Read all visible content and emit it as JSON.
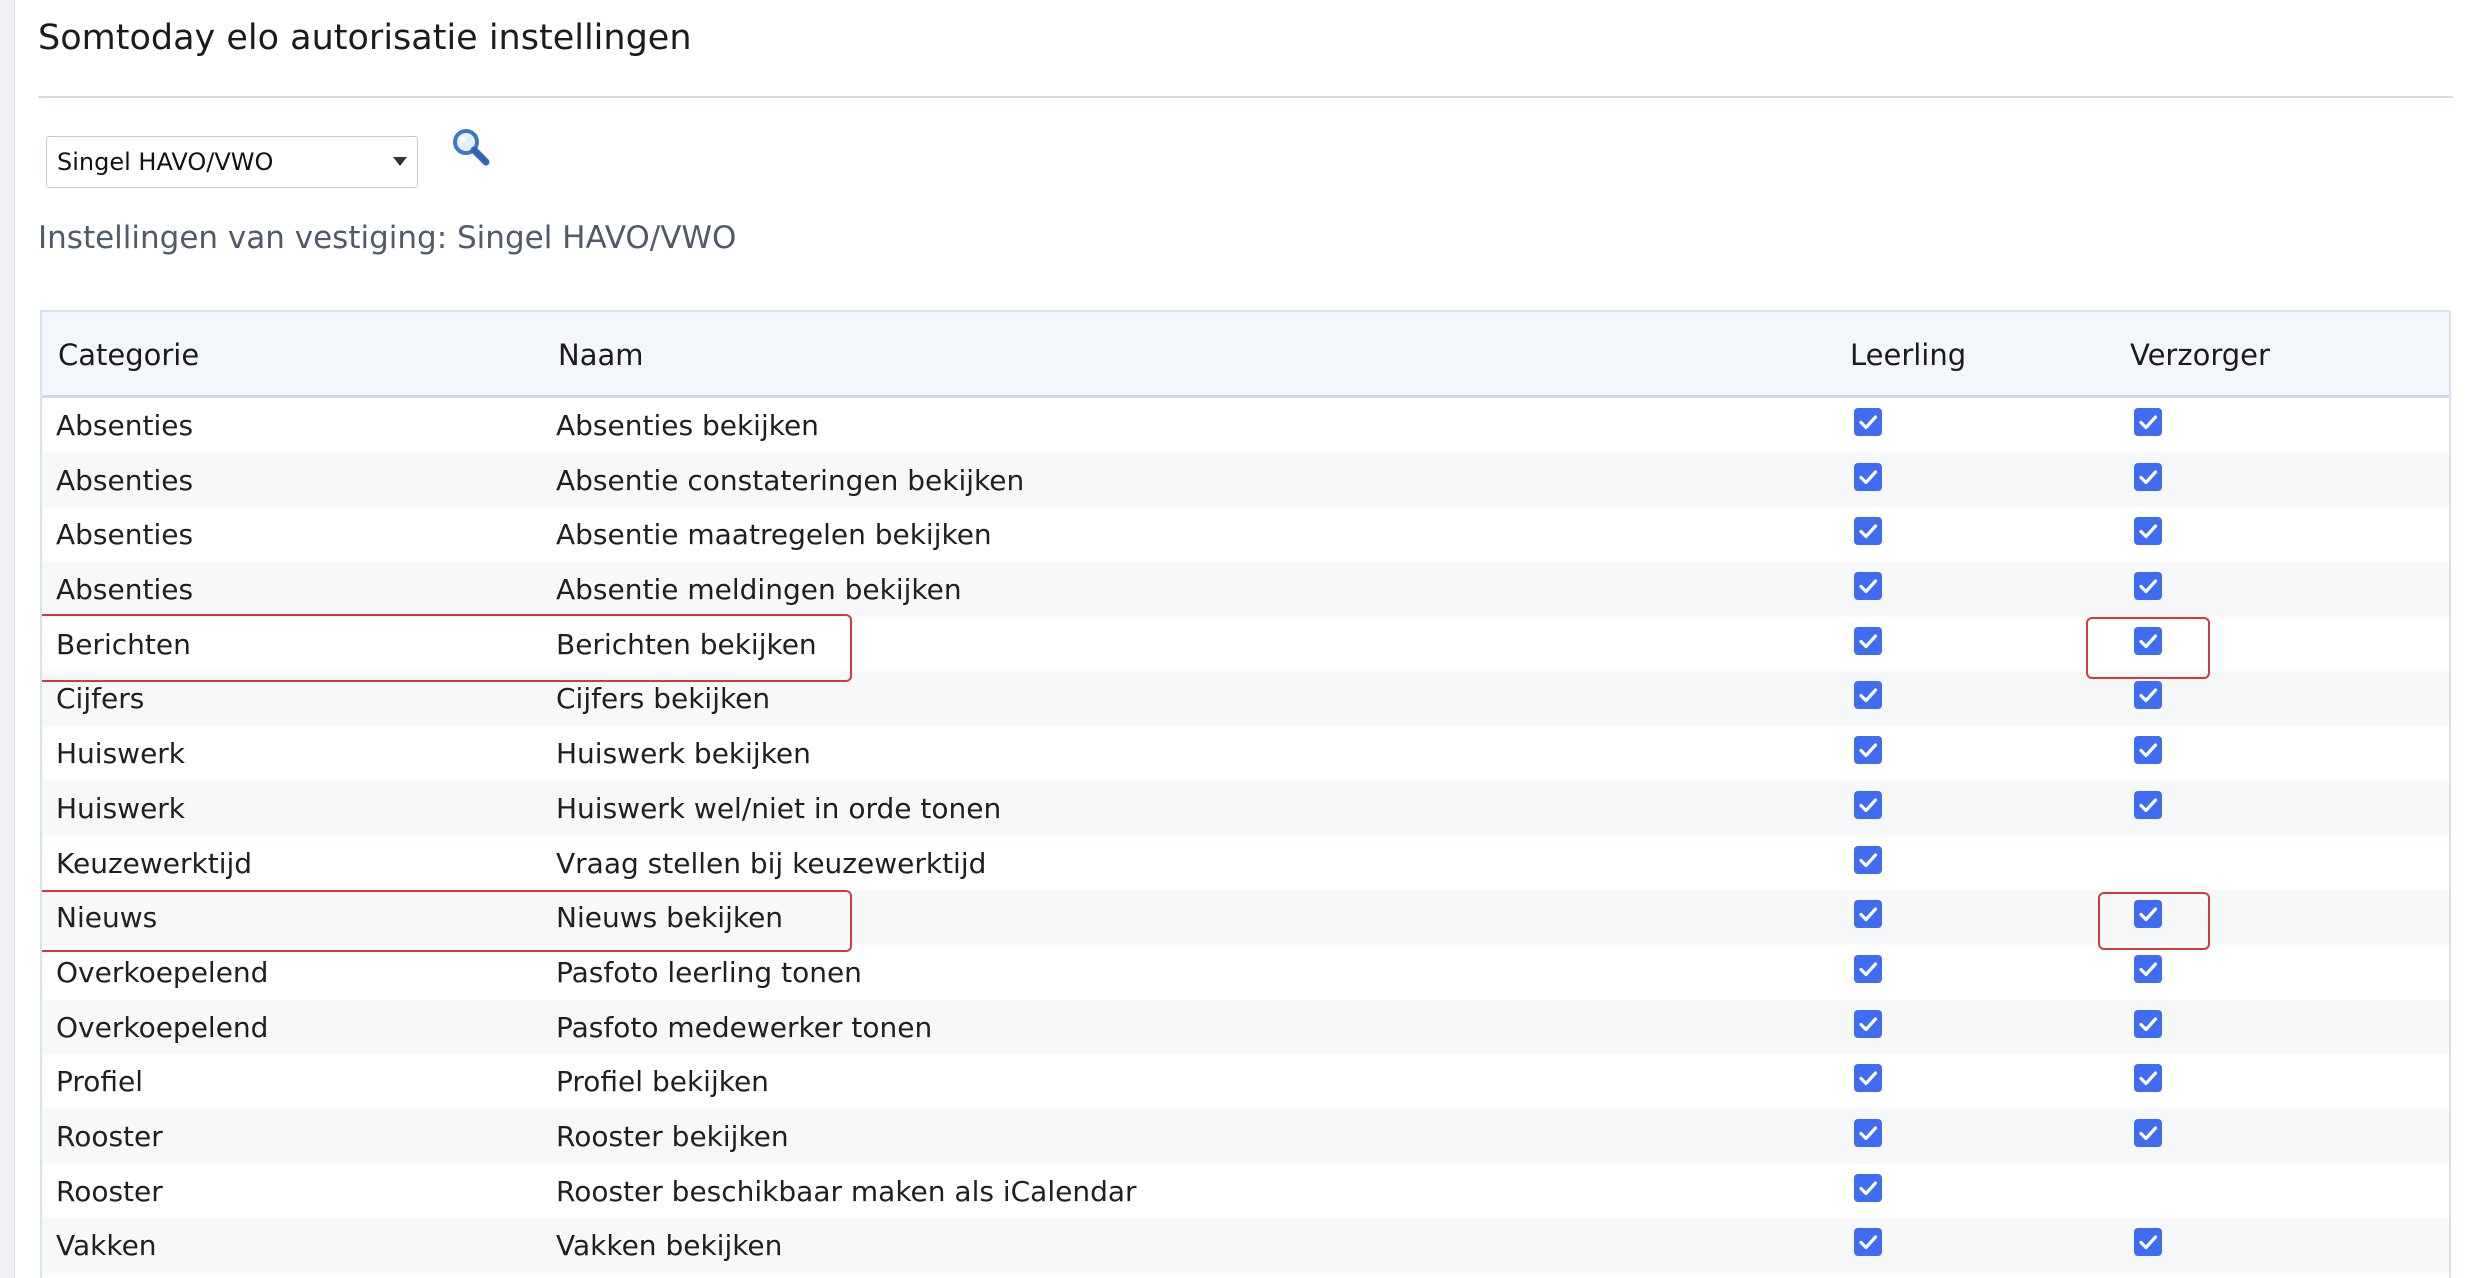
{
  "page": {
    "title": "Somtoday elo autorisatie instellingen",
    "subtitle": "Instellingen van vestiging: Singel HAVO/VWO"
  },
  "filter": {
    "location_selected": "Singel HAVO/VWO",
    "search_icon": "search-icon"
  },
  "table": {
    "headers": {
      "categorie": "Categorie",
      "naam": "Naam",
      "leerling": "Leerling",
      "verzorger": "Verzorger"
    },
    "rows": [
      {
        "categorie": "Absenties",
        "naam": "Absenties bekijken",
        "leerling": true,
        "verzorger": true
      },
      {
        "categorie": "Absenties",
        "naam": "Absentie constateringen bekijken",
        "leerling": true,
        "verzorger": true
      },
      {
        "categorie": "Absenties",
        "naam": "Absentie maatregelen bekijken",
        "leerling": true,
        "verzorger": true
      },
      {
        "categorie": "Absenties",
        "naam": "Absentie meldingen bekijken",
        "leerling": true,
        "verzorger": true
      },
      {
        "categorie": "Berichten",
        "naam": "Berichten bekijken",
        "leerling": true,
        "verzorger": true
      },
      {
        "categorie": "Cijfers",
        "naam": "Cijfers bekijken",
        "leerling": true,
        "verzorger": true
      },
      {
        "categorie": "Huiswerk",
        "naam": "Huiswerk bekijken",
        "leerling": true,
        "verzorger": true
      },
      {
        "categorie": "Huiswerk",
        "naam": "Huiswerk wel/niet in orde tonen",
        "leerling": true,
        "verzorger": true
      },
      {
        "categorie": "Keuzewerktijd",
        "naam": "Vraag stellen bij keuzewerktijd",
        "leerling": true,
        "verzorger": false
      },
      {
        "categorie": "Nieuws",
        "naam": "Nieuws bekijken",
        "leerling": true,
        "verzorger": true
      },
      {
        "categorie": "Overkoepelend",
        "naam": "Pasfoto leerling tonen",
        "leerling": true,
        "verzorger": true
      },
      {
        "categorie": "Overkoepelend",
        "naam": "Pasfoto medewerker tonen",
        "leerling": true,
        "verzorger": true
      },
      {
        "categorie": "Profiel",
        "naam": "Profiel bekijken",
        "leerling": true,
        "verzorger": true
      },
      {
        "categorie": "Rooster",
        "naam": "Rooster bekijken",
        "leerling": true,
        "verzorger": true
      },
      {
        "categorie": "Rooster",
        "naam": "Rooster beschikbaar maken als iCalendar",
        "leerling": true,
        "verzorger": false
      },
      {
        "categorie": "Vakken",
        "naam": "Vakken bekijken",
        "leerling": true,
        "verzorger": true
      }
    ]
  },
  "colors": {
    "checkbox": "#3f6cf0",
    "highlight": "#d43a3a",
    "subtitle": "#505a6a"
  }
}
